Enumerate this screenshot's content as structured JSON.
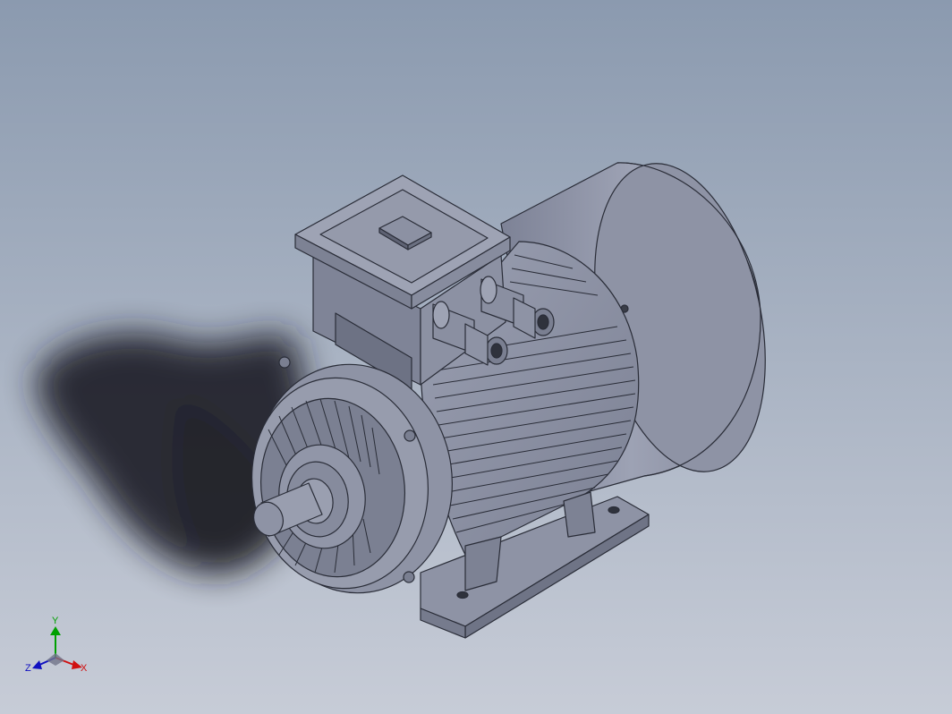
{
  "viewport": {
    "background_top": "#8c9bb0",
    "background_bottom": "#c6cbd6"
  },
  "model": {
    "body_color": "#8e93a5",
    "edge_color": "#2a2d38",
    "shadow_color": "#1a1c22"
  },
  "triad": {
    "y_label": "Y",
    "x_label": "X",
    "z_label": "Z",
    "y_color": "#00a000",
    "x_color": "#d01010",
    "z_color": "#1010c0"
  }
}
